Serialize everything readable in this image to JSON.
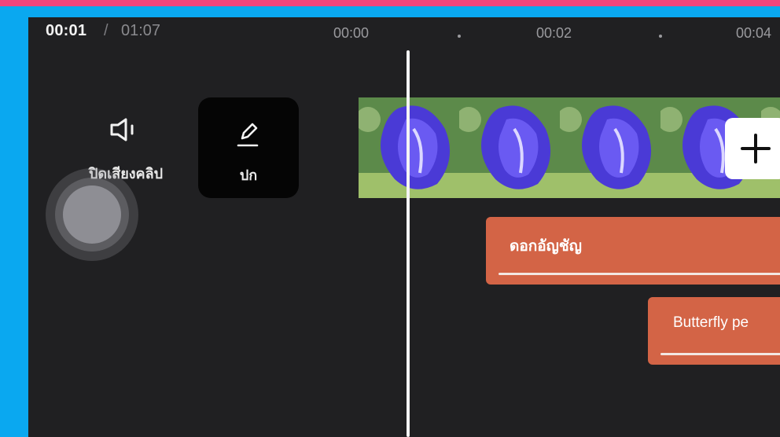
{
  "timecode": {
    "current": "00:01",
    "separator": "/",
    "total": "01:07"
  },
  "ruler": {
    "labels": [
      "00:00",
      "00:02",
      "00:04"
    ]
  },
  "actions": {
    "mute_label": "ปิดเสียงคลิป",
    "cover_label": "ปก"
  },
  "text_clips": [
    {
      "text": "ดอกอัญชัญ"
    },
    {
      "text": "Butterfly pe"
    }
  ],
  "colors": {
    "accent_stripe": "#f2457c",
    "frame_border": "#0aa8f0",
    "editor_bg": "#202022",
    "text_clip": "#d36446"
  },
  "icons": {
    "mute": "speaker-muted-icon",
    "cover": "pencil-edit-icon",
    "add": "plus-icon"
  }
}
